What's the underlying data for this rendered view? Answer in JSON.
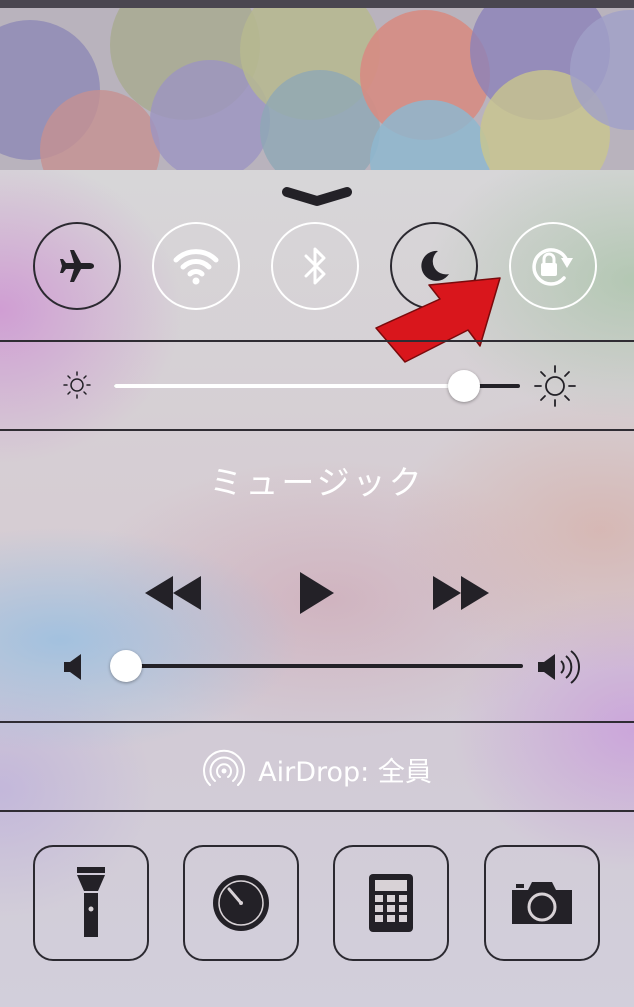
{
  "wallpaper": {
    "description_icon": "wallpaper-image"
  },
  "control_center": {
    "handle_icon": "chevron-down-icon",
    "toggles": [
      {
        "icon": "airplane-icon",
        "state": "off"
      },
      {
        "icon": "wifi-icon",
        "state": "on"
      },
      {
        "icon": "bluetooth-icon",
        "state": "on"
      },
      {
        "icon": "moon-icon",
        "state": "off"
      },
      {
        "icon": "rotation-lock-icon",
        "state": "on"
      }
    ],
    "brightness": {
      "level": 0.87,
      "min_icon": "sun-small-icon",
      "max_icon": "sun-large-icon"
    },
    "music": {
      "title": "ミュージック",
      "controls": [
        "rewind-icon",
        "play-icon",
        "fast-forward-icon"
      ],
      "volume": {
        "level": 0.03,
        "min_icon": "speaker-low-icon",
        "max_icon": "speaker-high-icon"
      }
    },
    "airdrop": {
      "label": "AirDrop: 全員",
      "icon": "airdrop-icon"
    },
    "shortcuts": [
      "flashlight-icon",
      "clock-icon",
      "calculator-icon",
      "camera-icon"
    ]
  },
  "annotation": {
    "icon": "red-arrow-icon",
    "color": "#d9161c"
  }
}
